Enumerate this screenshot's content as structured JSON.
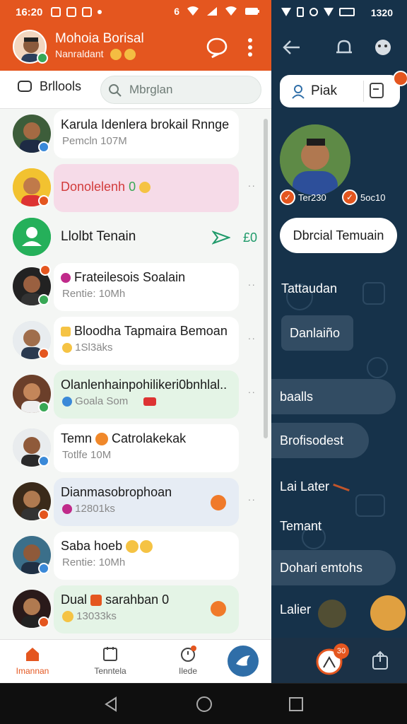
{
  "status_left": {
    "time": "16:20"
  },
  "status_right": {
    "time": "1320"
  },
  "header": {
    "title": "Mohoia Borisal",
    "subtitle": "Nanraldant"
  },
  "filter": {
    "tab_label": "Brllools",
    "search_placeholder": "Mbrglan"
  },
  "chats": [
    {
      "name": "Karula Idenlera brokail Rnnge",
      "meta": "Pemcln 107M",
      "badge_color": "#3a89d8",
      "card_color": "#ffffff"
    },
    {
      "name": "Donolelenh",
      "meta": "",
      "name_suffix": "0",
      "badge_color": "#e4561f",
      "card_color": "#f6dbe8",
      "name_color": "#d23b3b"
    },
    {
      "name": "Llolbt Tenain",
      "meta": "",
      "badge_color": "",
      "card_color": "transparent",
      "trail": "£0"
    },
    {
      "name": "Frateilesois Soalain",
      "meta": "Rentie: 10Mh",
      "badge_color": "#38a855",
      "card_color": "#ffffff"
    },
    {
      "name": "Bloodha Tapmaira Bemoan",
      "meta": "1Sl3äks",
      "badge_color": "#e4561f",
      "card_color": "#ffffff"
    },
    {
      "name": "Olanlenhainpohilikeri0bnhlal..",
      "meta": "Goala Som",
      "badge_color": "#38a855",
      "card_color": "#e4f4e6"
    },
    {
      "name": "Temn",
      "name_suffix": "Catrolakekak",
      "meta": "Totlfe 10M",
      "badge_color": "#3a89d8",
      "card_color": "#ffffff"
    },
    {
      "name": "Dianmasobrophoan",
      "meta": "12801ks",
      "badge_color": "#e4561f",
      "card_color": "#e6ecf4"
    },
    {
      "name": "Saba hoeb",
      "meta": "Rentie: 10Mh",
      "badge_color": "#3a89d8",
      "card_color": "#ffffff"
    },
    {
      "name": "Dual",
      "name_suffix": "sarahban 0",
      "meta": "13033ks",
      "badge_color": "#e4561f",
      "card_color": "#e4f4e6"
    }
  ],
  "bottomnav": [
    {
      "label": "Imannan",
      "color": "#e4561f"
    },
    {
      "label": "Tenntela",
      "color": "#555555"
    },
    {
      "label": "Ilede",
      "color": "#555555"
    }
  ],
  "right": {
    "profile_pill": "Piak",
    "tag_left": "Ter230",
    "tag_right": "5oc10",
    "official_button": "Dbrcial Temuain",
    "list": [
      {
        "label": "Tattaudan",
        "chip": false
      },
      {
        "label": "Danlaiño",
        "chip": true
      },
      {
        "label": "baalls",
        "chip": true
      },
      {
        "label": "Brofisodest",
        "chip": true
      },
      {
        "label": "Lai Later",
        "chip": false
      },
      {
        "label": "Temant",
        "chip": false
      },
      {
        "label": "Dohari emtohs",
        "chip": true
      },
      {
        "label": "Lalier",
        "chip": false
      }
    ],
    "notif_count": "30"
  },
  "colors": {
    "accent": "#e4561f",
    "dark_panel": "#16324a",
    "blue": "#2f6ea8"
  }
}
